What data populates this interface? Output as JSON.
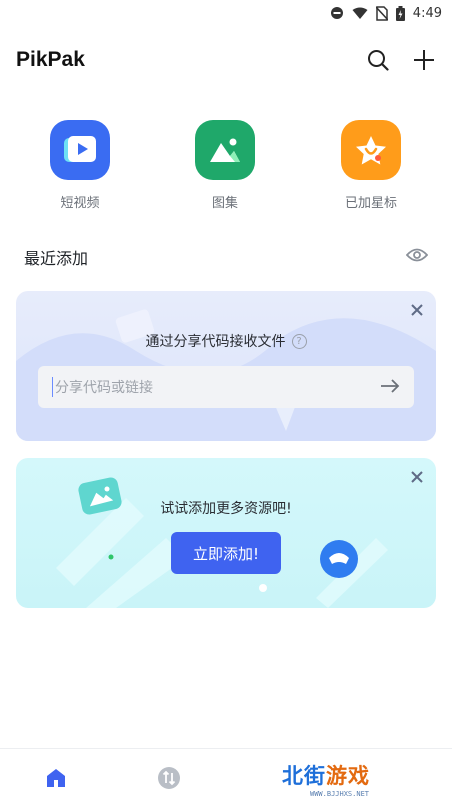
{
  "status_bar": {
    "time": "4:49",
    "icons": [
      "dnd-icon",
      "wifi-icon",
      "no-sim-icon",
      "battery-charging-icon"
    ]
  },
  "app": {
    "title": "PikPak"
  },
  "appbar": {
    "icons": [
      "search-icon",
      "add-icon"
    ]
  },
  "shortcuts": [
    {
      "label": "短视频",
      "icon": "video-icon",
      "color": "#3a6cf2"
    },
    {
      "label": "图集",
      "icon": "image-icon",
      "color": "#1fa86a"
    },
    {
      "label": "已加星标",
      "icon": "star-icon",
      "color": "#ff9c1a"
    }
  ],
  "recent": {
    "title": "最近添加",
    "icon": "eye-icon"
  },
  "share_card": {
    "title": "通过分享代码接收文件",
    "help_icon": "help-icon",
    "input_placeholder": "分享代码或链接",
    "submit_icon": "arrow-right-icon",
    "close_icon": "close-icon"
  },
  "add_card": {
    "text": "试试添加更多资源吧!",
    "button_label": "立即添加!",
    "close_icon": "close-icon"
  },
  "bottom_nav": [
    {
      "name": "home",
      "icon": "home-icon",
      "active": true
    },
    {
      "name": "transfer",
      "icon": "transfer-icon",
      "active": false
    }
  ],
  "watermark": {
    "part1": "北街",
    "part2": "游戏",
    "url": "WWW.BJJHXS.NET"
  },
  "colors": {
    "accent": "#3f63f0",
    "close": "#5f6b86"
  }
}
